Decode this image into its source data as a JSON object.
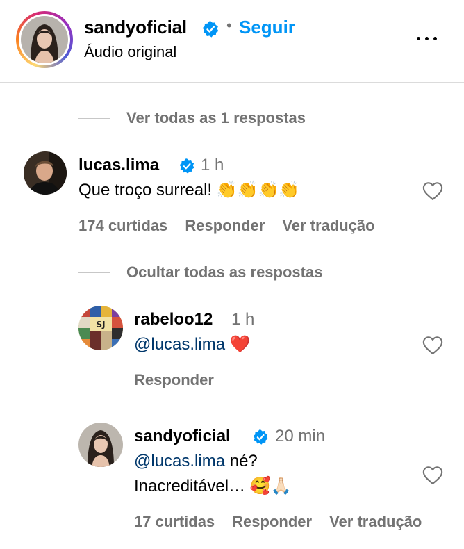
{
  "header": {
    "username": "sandyoficial",
    "separator": "•",
    "follow_label": "Seguir",
    "subtitle": "Áudio original"
  },
  "thread": {
    "view_replies": "Ver todas as 1 respostas",
    "hide_replies": "Ocultar todas as respostas"
  },
  "comments": [
    {
      "username": "lucas.lima",
      "time": "1 h",
      "text": "Que troço surreal! 👏👏👏👏",
      "likes": "174 curtidas",
      "reply_label": "Responder",
      "translate_label": "Ver tradução"
    },
    {
      "username": "rabeloo12",
      "time": "1 h",
      "mention": "@lucas.lima",
      "text": " ❤️",
      "reply_label": "Responder"
    },
    {
      "username": "sandyoficial",
      "time": "20 min",
      "mention": "@lucas.lima",
      "text_line1": " né?",
      "text_line2": "Inacreditável… 🥰🙏🏻",
      "likes": "17 curtidas",
      "reply_label": "Responder",
      "translate_label": "Ver tradução"
    }
  ],
  "colors": {
    "accent": "#0095f6",
    "verified": "#0095f6",
    "mention": "#00376b",
    "muted": "#737373"
  }
}
